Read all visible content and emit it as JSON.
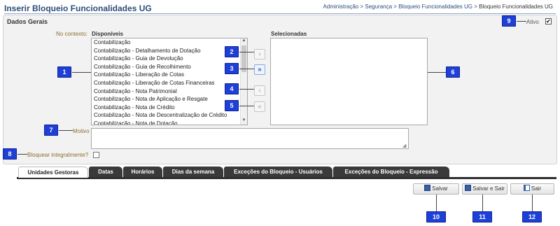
{
  "header": {
    "title": "Inserir Bloqueio Funcionalidades UG",
    "breadcrumb": [
      "Administração",
      "Segurança",
      "Bloqueio Funcionalidades UG"
    ],
    "breadcrumb_current": "Bloqueio Funcionalidades UG",
    "separator": " > "
  },
  "panel": {
    "title": "Dados Gerais",
    "ativo_label": "Ativo",
    "ativo_checked": true,
    "ativo_mark": "✔"
  },
  "form": {
    "no_contexto_label": "No contexto:",
    "disponiveis_label": "Disponíveis",
    "selecionadas_label": "Selecionadas",
    "available_items": [
      "Contabilização",
      "Contabilização - Detalhamento de Dotação",
      "Contabilização - Guia de Devolução",
      "Contabilização - Guia de Recolhimento",
      "Contabilização - Liberação de Cotas",
      "Contabilização - Liberação de Cotas Financeiras",
      "Contabilização - Nota Patrimonial",
      "Contabilização - Nota de Aplicação e Resgate",
      "Contabilização - Nota de Crédito",
      "Contabilização - Nota de Descentralização de Crédito",
      "Contabilização - Nota de Dotação"
    ],
    "selected_items": [],
    "buttons": {
      "move_right": "›",
      "move_all_right": "»",
      "move_left": "‹",
      "move_all_left": "«"
    },
    "motivo_label": "Motivo",
    "motivo_value": "",
    "bloquear_label": "Bloquear integralmente?",
    "bloquear_checked": false
  },
  "tabs": [
    {
      "label": "Unidades Gestoras",
      "active": true
    },
    {
      "label": "Datas",
      "active": false
    },
    {
      "label": "Horários",
      "active": false
    },
    {
      "label": "Dias da semana",
      "active": false
    },
    {
      "label": "Exceções do Bloqueio - Usuários",
      "active": false
    },
    {
      "label": "Exceções do Bloqueio - Expressão",
      "active": false
    }
  ],
  "actions": {
    "salvar": "Salvar",
    "salvar_sair": "Salvar e Sair",
    "sair": "Sair"
  },
  "callouts": [
    "1",
    "2",
    "3",
    "4",
    "5",
    "6",
    "7",
    "8",
    "9",
    "10",
    "11",
    "12"
  ],
  "colors": {
    "callout": "#1f40d6",
    "title": "#2d4d7a",
    "label": "#8a7030",
    "tab_dark": "#3a3a3a"
  }
}
